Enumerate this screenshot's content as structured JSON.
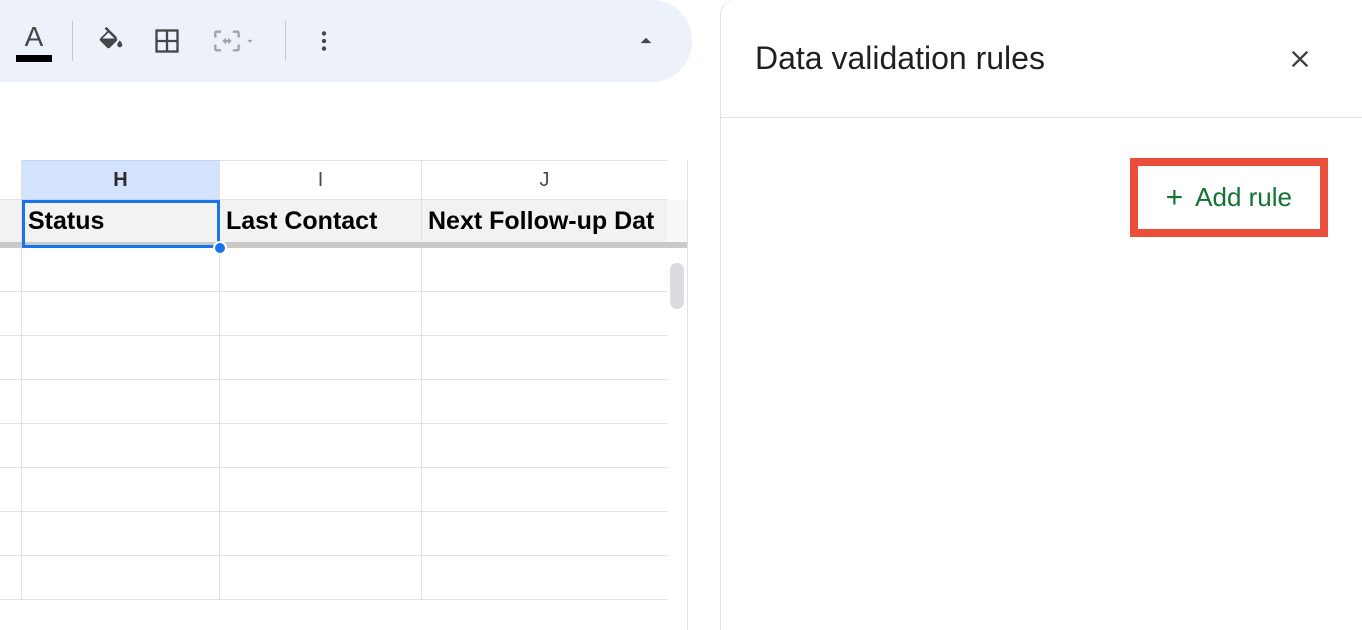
{
  "toolbar": {
    "text_color_letter": "A",
    "fill_color_name": "fill-color",
    "borders_name": "borders",
    "merge_name": "merge-cells",
    "more_name": "more-options"
  },
  "columns": {
    "H": {
      "letter": "H",
      "header": "Status"
    },
    "I": {
      "letter": "I",
      "header": "Last Contact"
    },
    "J": {
      "letter": "J",
      "header": "Next Follow-up Dat"
    }
  },
  "panel": {
    "title": "Data validation rules",
    "add_rule_label": "Add rule"
  }
}
